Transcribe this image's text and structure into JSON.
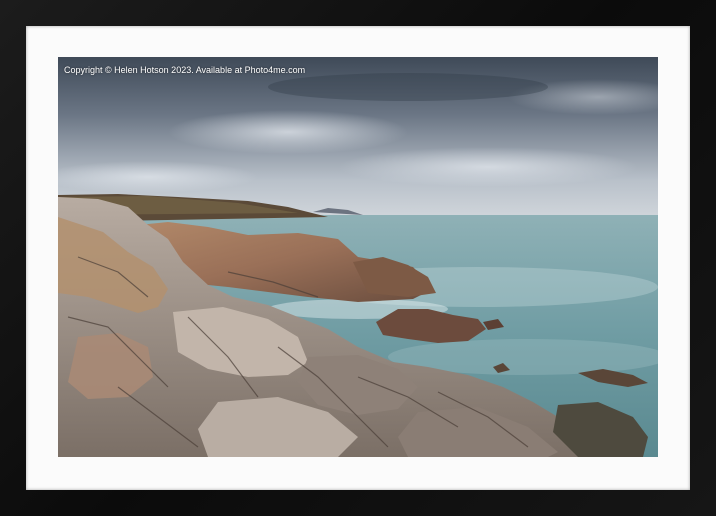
{
  "photo": {
    "copyright_text": "Copyright © Helen Hotson 2023. Available at Photo4me.com"
  },
  "colors": {
    "frame": "#141414",
    "mat": "#fbfbfb",
    "sky_dark": "#4a5563",
    "sky_light": "#c9d0d8",
    "sea": "#6f9ca3",
    "rock_warm": "#a57a5c",
    "rock_grey": "#9a948e"
  }
}
